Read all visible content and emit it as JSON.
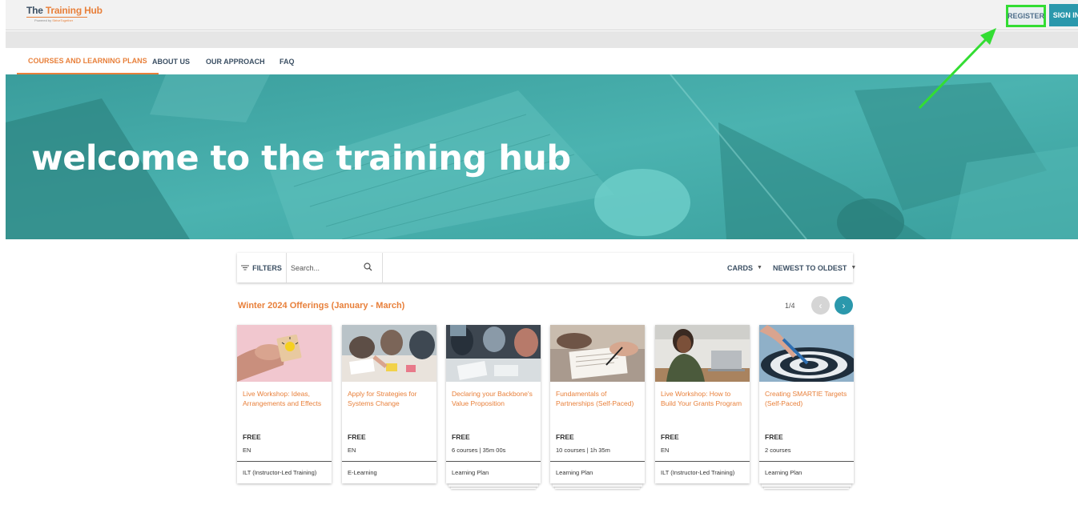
{
  "header": {
    "logo_part1": "The ",
    "logo_part2": "Training Hub",
    "logo_sub": "Powered by ",
    "logo_brand": "StriveTogether",
    "register_label": "REGISTER",
    "signin_label": "SIGN IN"
  },
  "nav": {
    "items": [
      {
        "label": "COURSES AND LEARNING PLANS"
      },
      {
        "label": "ABOUT US"
      },
      {
        "label": "OUR APPROACH"
      },
      {
        "label": "FAQ"
      }
    ]
  },
  "hero": {
    "title": "welcome to the training hub"
  },
  "toolbar": {
    "filters_label": "FILTERS",
    "search_placeholder": "Search...",
    "view_label": "CARDS",
    "sort_label": "NEWEST TO OLDEST"
  },
  "section": {
    "title": "Winter 2024 Offerings (January - March)",
    "pager": "1/4"
  },
  "cards": [
    {
      "title": "Live Workshop: Ideas, Arrangements and Effects",
      "price": "FREE",
      "meta": "EN",
      "type": "ILT (Instructor-Led Training)"
    },
    {
      "title": "Apply for Strategies for Systems Change",
      "price": "FREE",
      "meta": "EN",
      "type": "E-Learning"
    },
    {
      "title": "Declaring your Backbone's Value Proposition",
      "price": "FREE",
      "meta": "6 courses  |  35m 00s",
      "type": "Learning Plan"
    },
    {
      "title": "Fundamentals of Partnerships (Self-Paced)",
      "price": "FREE",
      "meta": "10 courses  |  1h 35m",
      "type": "Learning Plan"
    },
    {
      "title": "Live Workshop: How to Build Your Grants Program",
      "price": "FREE",
      "meta": "EN",
      "type": "ILT (Instructor-Led Training)"
    },
    {
      "title": "Creating SMARTIE Targets (Self-Paced)",
      "price": "FREE",
      "meta": "2 courses",
      "type": "Learning Plan"
    }
  ],
  "colors": {
    "accent_orange": "#e8803b",
    "accent_teal": "#2b98ac",
    "highlight_green": "#33dd33"
  }
}
